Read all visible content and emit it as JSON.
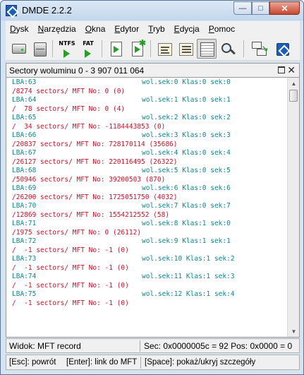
{
  "window": {
    "title": "DMDE 2.2.2",
    "min_glyph": "—",
    "max_glyph": "□",
    "close_glyph": "✕"
  },
  "menu": [
    "Dysk",
    "Narzędzia",
    "Okna",
    "Edytor",
    "Tryb",
    "Edycja",
    "Pomoc"
  ],
  "toolbar": {
    "ntfs_label": "NTFS",
    "fat_label": "FAT",
    "icons": [
      "drive-icon",
      "partition-icon",
      "ntfs-icon",
      "fat-icon",
      "open-file-icon",
      "new-file-icon",
      "list-view-icon",
      "detail-view-icon",
      "grid-view-icon",
      "search-icon",
      "copy-sectors-icon",
      "dmde-logo-icon"
    ]
  },
  "panel": {
    "title": "Sectory woluminu 0 - 3 907 011 064",
    "max_glyph": "",
    "close_glyph": "✕"
  },
  "records": [
    {
      "lba": "LBA:63",
      "location": "wol.sek:0 Klas:0 sek:0",
      "mft": "/8274 sectors/ MFT No: 0 (0)"
    },
    {
      "lba": "LBA:64",
      "location": "wol.sek:1 Klas:0 sek:1",
      "mft": "/  78 sectors/ MFT No: 0 (4)"
    },
    {
      "lba": "LBA:65",
      "location": "wol.sek:2 Klas:0 sek:2",
      "mft": "/  34 sectors/ MFT No: -1184443853 (0)"
    },
    {
      "lba": "LBA:66",
      "location": "wol.sek:3 Klas:0 sek:3",
      "mft": "/20837 sectors/ MFT No: 728170114 (35686)"
    },
    {
      "lba": "LBA:67",
      "location": "wol.sek:4 Klas:0 sek:4",
      "mft": "/26127 sectors/ MFT No: 220116495 (26322)"
    },
    {
      "lba": "LBA:68",
      "location": "wol.sek:5 Klas:0 sek:5",
      "mft": "/50946 sectors/ MFT No: 39200503 (870)"
    },
    {
      "lba": "LBA:69",
      "location": "wol.sek:6 Klas:0 sek:6",
      "mft": "/26200 sectors/ MFT No: 1725051750 (4032)"
    },
    {
      "lba": "LBA:70",
      "location": "wol.sek:7 Klas:0 sek:7",
      "mft": "/12869 sectors/ MFT No: 1554212552 (58)"
    },
    {
      "lba": "LBA:71",
      "location": "wol.sek:8 Klas:1 sek:0",
      "mft": "/1975 sectors/ MFT No: 0 (26112)"
    },
    {
      "lba": "LBA:72",
      "location": "wol.sek:9 Klas:1 sek:1",
      "mft": "/  -1 sectors/ MFT No: -1 (0)"
    },
    {
      "lba": "LBA:73",
      "location": "wol.sek:10 Klas:1 sek:2",
      "mft": "/  -1 sectors/ MFT No: -1 (0)"
    },
    {
      "lba": "LBA:74",
      "location": "wol.sek:11 Klas:1 sek:3",
      "mft": "/  -1 sectors/ MFT No: -1 (0)"
    },
    {
      "lba": "LBA:75",
      "location": "wol.sek:12 Klas:1 sek:4",
      "mft": "/  -1 sectors/ MFT No: -1 (0)"
    }
  ],
  "scrollbar": {
    "up_glyph": "▲",
    "down_glyph": "▼"
  },
  "status": {
    "view": "Widok: MFT record",
    "position": "Sec: 0x0000005c = 92  Pos: 0x0000 = 0"
  },
  "help": {
    "esc": "[Esc]: powrót",
    "enter": "[Enter]: link do MFT",
    "space": "[Space]: pokaż/ukryj szczegóły"
  },
  "colors": {
    "lba_text": "#0f8590",
    "mft_text": "#c0152c",
    "frame": "#d6e3f1",
    "close_button": "#c9452f"
  }
}
